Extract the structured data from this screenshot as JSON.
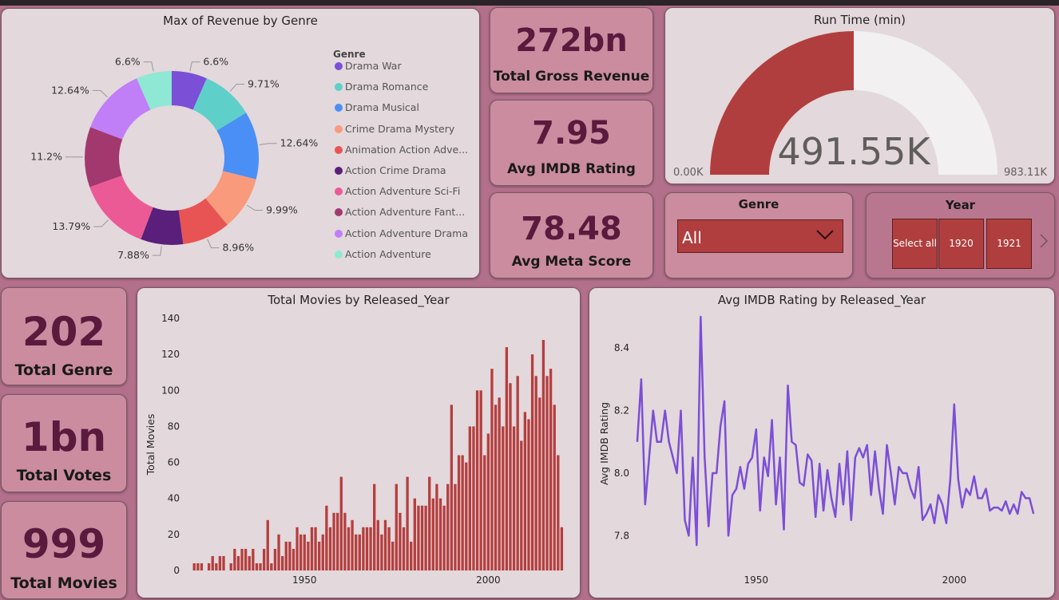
{
  "colors": {
    "bar": "#b53e3e",
    "line": "#7b4fd6",
    "gauge_fill": "#b13e3e",
    "gauge_bg": "#f2f0f0",
    "kpi_value": "#5a1a3e"
  },
  "donut": {
    "title": "Max of Revenue by Genre",
    "legend_title": "Genre",
    "legend": [
      "Drama War",
      "Drama Romance",
      "Drama Musical",
      "Crime Drama Mystery",
      "Animation Action Adve...",
      "Action Crime Drama",
      "Action Adventure Sci-Fi",
      "Action Adventure Fant...",
      "Action Adventure Drama",
      "Action Adventure"
    ]
  },
  "kpis": {
    "gross_value": "272bn",
    "gross_label": "Total Gross Revenue",
    "imdb_value": "7.95",
    "imdb_label": "Avg IMDB Rating",
    "meta_value": "78.48",
    "meta_label": "Avg Meta Score",
    "genre_value": "202",
    "genre_label": "Total Genre",
    "votes_value": "1bn",
    "votes_label": "Total Votes",
    "movies_value": "999",
    "movies_label": "Total Movies"
  },
  "gauge": {
    "title": "Run Time (min)",
    "value_label": "491.55K",
    "min_label": "0.00K",
    "max_label": "983.11K",
    "fraction": 0.5
  },
  "genre_slicer": {
    "title": "Genre",
    "selected": "All",
    "chevron_icon": "chevron-down-icon"
  },
  "year_slicer": {
    "title": "Year",
    "buttons": [
      "Select all",
      "1920",
      "1921"
    ],
    "next_icon": "chevron-right-icon"
  },
  "chart_data": [
    {
      "type": "pie",
      "title": "Max of Revenue by Genre",
      "categories": [
        "Drama War",
        "Drama Romance",
        "Drama Musical",
        "Crime Drama Mystery",
        "Animation Action Adve...",
        "Action Crime Drama",
        "Action Adventure Sci-Fi",
        "Action Adventure Fant...",
        "Action Adventure Drama",
        "Action Adventure"
      ],
      "values": [
        6.6,
        9.71,
        12.64,
        9.99,
        8.96,
        7.88,
        13.79,
        11.2,
        12.64,
        6.6
      ],
      "labels": [
        "6.6%",
        "9.71%",
        "12.64%",
        "9.99%",
        "8.96%",
        "7.88%",
        "13.79%",
        "11.2%",
        "12.64%",
        "6.6%"
      ],
      "colors": [
        "#7b4fd6",
        "#5ecfc9",
        "#4a8ff5",
        "#f99a7c",
        "#e85454",
        "#5a1f7a",
        "#ec5a96",
        "#a3386f",
        "#c07ef7",
        "#8ee8d3"
      ],
      "legend": "right"
    },
    {
      "type": "bar",
      "title": "Total Movies by Released_Year",
      "xlabel": "",
      "ylabel": "Total Movies",
      "ylim": [
        0,
        140
      ],
      "yticks": [
        "0",
        "20",
        "40",
        "60",
        "80",
        "100",
        "120",
        "140"
      ],
      "xticks": [
        "1950",
        "2000"
      ],
      "x": [
        1920,
        1921,
        1922,
        1923,
        1924,
        1925,
        1926,
        1927,
        1928,
        1929,
        1930,
        1931,
        1932,
        1933,
        1934,
        1935,
        1936,
        1937,
        1938,
        1939,
        1940,
        1941,
        1942,
        1943,
        1944,
        1945,
        1946,
        1947,
        1948,
        1949,
        1950,
        1951,
        1952,
        1953,
        1954,
        1955,
        1956,
        1957,
        1958,
        1959,
        1960,
        1961,
        1962,
        1963,
        1964,
        1965,
        1966,
        1967,
        1968,
        1969,
        1970,
        1971,
        1972,
        1973,
        1974,
        1975,
        1976,
        1977,
        1978,
        1979,
        1980,
        1981,
        1982,
        1983,
        1984,
        1985,
        1986,
        1987,
        1988,
        1989,
        1990,
        1991,
        1992,
        1993,
        1994,
        1995,
        1996,
        1997,
        1998,
        1999,
        2000,
        2001,
        2002,
        2003,
        2004,
        2005,
        2006,
        2007,
        2008,
        2009,
        2010,
        2011,
        2012,
        2013,
        2014,
        2015,
        2016,
        2017,
        2018,
        2019,
        2020
      ],
      "values": [
        4,
        4,
        4,
        0,
        4,
        8,
        4,
        8,
        8,
        0,
        4,
        12,
        8,
        12,
        12,
        8,
        12,
        4,
        4,
        12,
        28,
        4,
        12,
        20,
        8,
        16,
        16,
        12,
        24,
        20,
        20,
        16,
        24,
        24,
        16,
        20,
        36,
        24,
        32,
        32,
        52,
        32,
        24,
        28,
        20,
        20,
        24,
        24,
        24,
        48,
        28,
        20,
        28,
        24,
        16,
        48,
        32,
        24,
        52,
        16,
        40,
        36,
        36,
        36,
        52,
        40,
        48,
        40,
        36,
        48,
        92,
        48,
        64,
        64,
        60,
        80,
        80,
        100,
        100,
        64,
        76,
        112,
        92,
        96,
        80,
        124,
        104,
        80,
        108,
        72,
        88,
        84,
        120,
        108,
        96,
        128,
        108,
        112,
        92,
        64,
        24
      ],
      "grid": false
    },
    {
      "type": "line",
      "title": "Avg IMDB Rating by Released_Year",
      "xlabel": "",
      "ylabel": "Avg IMDB Rating",
      "ylim": [
        7.75,
        8.5
      ],
      "yticks": [
        "7.8",
        "8.0",
        "8.2",
        "8.4"
      ],
      "xticks": [
        "1950",
        "2000"
      ],
      "x": [
        1920,
        1921,
        1922,
        1923,
        1924,
        1925,
        1926,
        1927,
        1928,
        1929,
        1930,
        1931,
        1932,
        1933,
        1934,
        1935,
        1936,
        1937,
        1938,
        1939,
        1940,
        1941,
        1942,
        1943,
        1944,
        1945,
        1946,
        1947,
        1948,
        1949,
        1950,
        1951,
        1952,
        1953,
        1954,
        1955,
        1956,
        1957,
        1958,
        1959,
        1960,
        1961,
        1962,
        1963,
        1964,
        1965,
        1966,
        1967,
        1968,
        1969,
        1970,
        1971,
        1972,
        1973,
        1974,
        1975,
        1976,
        1977,
        1978,
        1979,
        1980,
        1981,
        1982,
        1983,
        1984,
        1985,
        1986,
        1987,
        1988,
        1989,
        1990,
        1991,
        1992,
        1993,
        1994,
        1995,
        1996,
        1997,
        1998,
        1999,
        2000,
        2001,
        2002,
        2003,
        2004,
        2005,
        2006,
        2007,
        2008,
        2009,
        2010,
        2011,
        2012,
        2013,
        2014,
        2015,
        2016,
        2017,
        2018,
        2019,
        2020
      ],
      "values": [
        8.1,
        8.3,
        7.9,
        8.05,
        8.2,
        8.1,
        8.1,
        8.2,
        8.1,
        8.05,
        8.0,
        8.2,
        7.85,
        7.8,
        8.05,
        7.77,
        8.5,
        8.05,
        7.83,
        8.0,
        8.0,
        8.15,
        8.23,
        7.8,
        7.93,
        7.95,
        8.02,
        7.95,
        8.03,
        8.05,
        8.14,
        7.88,
        8.05,
        7.99,
        8.17,
        7.9,
        8.05,
        7.82,
        8.28,
        8.1,
        8.09,
        7.97,
        7.96,
        8.06,
        8.04,
        7.86,
        8.03,
        7.88,
        8.01,
        7.92,
        7.86,
        8.03,
        7.9,
        8.07,
        7.85,
        8.05,
        8.08,
        8.05,
        8.09,
        7.93,
        8.07,
        7.95,
        7.87,
        8.09,
        8.0,
        7.9,
        8.02,
        8.0,
        8.0,
        7.95,
        7.92,
        8.02,
        7.85,
        7.87,
        7.9,
        7.84,
        7.93,
        7.9,
        7.84,
        7.98,
        8.22,
        7.98,
        7.89,
        7.95,
        7.93,
        7.99,
        7.92,
        7.92,
        7.95,
        7.88,
        7.89,
        7.89,
        7.88,
        7.91,
        7.87,
        7.9,
        7.87,
        7.94,
        7.92,
        7.92,
        7.87,
        7.94,
        7.89,
        8.0,
        8.0,
        8.13
      ],
      "grid": false
    }
  ]
}
